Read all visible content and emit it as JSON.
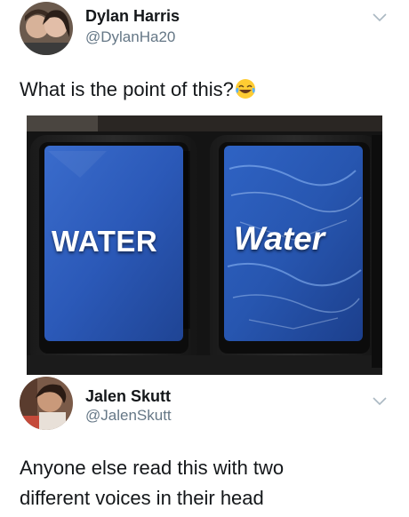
{
  "tweet": {
    "author_name": "Dylan Harris",
    "author_handle": "@DylanHa20",
    "text": "What is the point of this?",
    "emoji": "face-with-tears-of-joy",
    "media": {
      "left_button_label": "WATER",
      "right_button_label": "Water"
    }
  },
  "reply": {
    "author_name": "Jalen Skutt",
    "author_handle": "@JalenSkutt",
    "text_line1": "Anyone else read this with two",
    "text_line2": "different voices in their head"
  },
  "colors": {
    "text_primary": "#14171a",
    "text_secondary": "#657786",
    "chevron": "#aab8c2",
    "button_blue": "#2b5bb5"
  },
  "icons": {
    "menu": "chevron-down-icon",
    "emoji": "laughing-crying-emoji-icon"
  }
}
